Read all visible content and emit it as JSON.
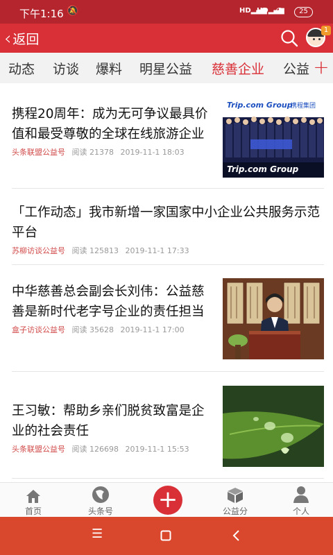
{
  "status_bar": {
    "time": "下午1:16",
    "signal1": "HD",
    "signal2": "HD",
    "battery": "25"
  },
  "nav": {
    "back_label": "返回",
    "badge_count": "1"
  },
  "tabs": [
    {
      "label": "动态",
      "active": false
    },
    {
      "label": "访谈",
      "active": false
    },
    {
      "label": "爆料",
      "active": false
    },
    {
      "label": "明星公益",
      "active": false
    },
    {
      "label": "慈善企业",
      "active": true
    },
    {
      "label": "公益",
      "active": false
    }
  ],
  "feed": [
    {
      "title": "携程20周年：成为无可争议最具价值和最受尊敬的全球在线旅游企业",
      "source": "头条联盟公益号",
      "reads": "阅读 21378",
      "time": "2019-11-1 18:03",
      "image": {
        "brand_top": "Trip.com Group",
        "brand_cn": "携程集团",
        "brand_bottom": "Trip.com Group"
      }
    },
    {
      "title": "「工作动态」我市新增一家国家中小企业公共服务示范平台",
      "source": "苏柳访谈公益号",
      "reads": "阅读 125813",
      "time": "2019-11-1 17:33"
    },
    {
      "title": "中华慈善总会副会长刘伟：公益慈善是新时代老字号企业的责任担当",
      "source": "盒子访谈公益号",
      "reads": "阅读 35628",
      "time": "2019-11-1 17:00"
    },
    {
      "title": "王习敏：帮助乡亲们脱贫致富是企业的社会责任",
      "source": "头条联盟公益号",
      "reads": "阅读 126698",
      "time": "2019-11-1 15:53"
    }
  ],
  "bottom_tabs": [
    {
      "label": "首页",
      "icon": "home-icon"
    },
    {
      "label": "头条号",
      "icon": "headline-icon"
    },
    {
      "label": "",
      "icon": "plus-icon"
    },
    {
      "label": "公益分",
      "icon": "cube-icon"
    },
    {
      "label": "个人",
      "icon": "person-icon"
    }
  ],
  "colors": {
    "brand": "#d92f37",
    "status": "#b5252e",
    "source_text": "#d24a4a"
  }
}
